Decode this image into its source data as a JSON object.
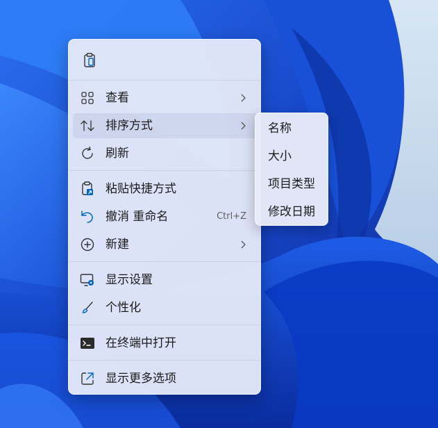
{
  "desktop": {
    "wallpaper": "windows-11-bloom"
  },
  "context_menu": {
    "quick_actions": [
      {
        "name": "paste",
        "icon": "clipboard-icon"
      }
    ],
    "items": [
      {
        "label": "查看",
        "icon": "grid-view-icon",
        "has_submenu": true
      },
      {
        "label": "排序方式",
        "icon": "sort-arrows-icon",
        "has_submenu": true,
        "highlighted": true
      },
      {
        "label": "刷新",
        "icon": "refresh-icon"
      },
      {
        "label": "粘贴快捷方式",
        "icon": "paste-shortcut-icon"
      },
      {
        "label": "撤消 重命名",
        "icon": "undo-icon",
        "shortcut": "Ctrl+Z"
      },
      {
        "label": "新建",
        "icon": "add-circle-icon",
        "has_submenu": true
      },
      {
        "label": "显示设置",
        "icon": "display-settings-icon"
      },
      {
        "label": "个性化",
        "icon": "brush-icon"
      },
      {
        "label": "在终端中打开",
        "icon": "terminal-icon"
      },
      {
        "label": "显示更多选项",
        "icon": "open-external-icon"
      }
    ]
  },
  "sort_submenu": {
    "items": [
      {
        "label": "名称"
      },
      {
        "label": "大小"
      },
      {
        "label": "项目类型"
      },
      {
        "label": "修改日期"
      }
    ]
  },
  "colors": {
    "accent": "#0067c0",
    "menu_bg": "#e4e8f8",
    "text": "#1b1b1b"
  }
}
